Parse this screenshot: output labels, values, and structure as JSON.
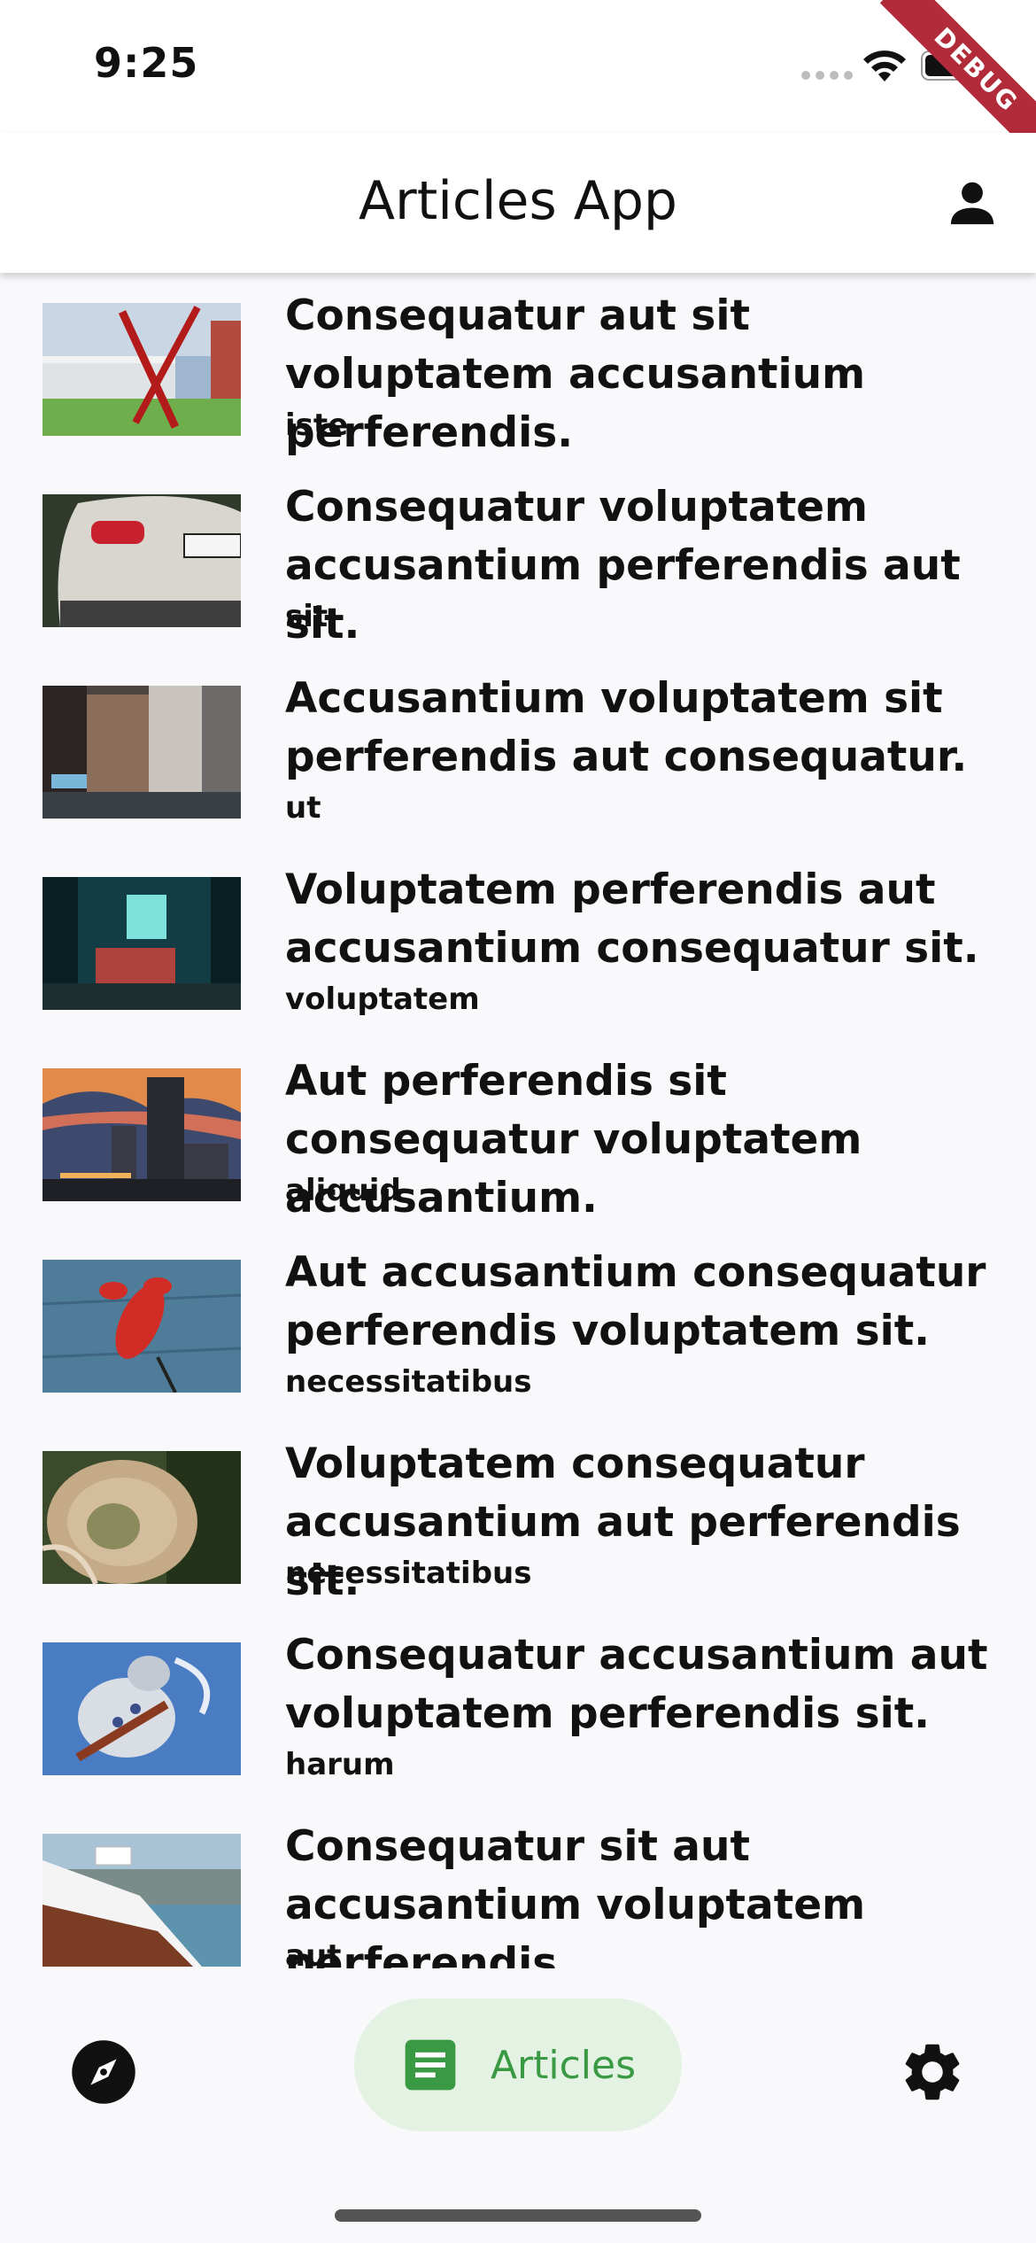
{
  "status_bar": {
    "time": "9:25",
    "debug_banner": "DEBUG"
  },
  "app_bar": {
    "title": "Articles App",
    "profile_icon": "person-icon"
  },
  "articles": [
    {
      "title": "Consequatur aut sit voluptatem accusantium perferendis.",
      "tag": "iste",
      "thumbnail": "building-sculpture"
    },
    {
      "title": "Consequatur voluptatem accusantium perferendis aut sit.",
      "tag": "sit",
      "thumbnail": "car-rear"
    },
    {
      "title": "Accusantium voluptatem sit perferendis aut consequatur.",
      "tag": "ut",
      "thumbnail": "city-billboards"
    },
    {
      "title": "Voluptatem perferendis aut accusantium consequatur sit.",
      "tag": "voluptatem",
      "thumbnail": "teal-room"
    },
    {
      "title": "Aut perferendis sit consequatur voluptatem accusantium.",
      "tag": "aliquid",
      "thumbnail": "skyline-sunset"
    },
    {
      "title": "Aut accusantium consequatur perferendis voluptatem sit.",
      "tag": "necessitatibus",
      "thumbnail": "lobster"
    },
    {
      "title": "Voluptatem consequatur accusantium aut perferendis sit.",
      "tag": "necessitatibus",
      "thumbnail": "aerial-road"
    },
    {
      "title": "Consequatur accusantium aut voluptatem perferendis sit.",
      "tag": "harum",
      "thumbnail": "dragon-statue"
    },
    {
      "title": "Consequatur sit aut accusantium voluptatem perferendis.",
      "tag": "aut",
      "thumbnail": "boat"
    }
  ],
  "bottom_nav": {
    "items": [
      {
        "icon": "compass-icon",
        "label": ""
      },
      {
        "icon": "article-icon",
        "label": "Articles",
        "selected": true
      },
      {
        "icon": "gear-icon",
        "label": ""
      }
    ],
    "accent_color": "#3a9a44",
    "selected_background": "#e4f2e4"
  }
}
